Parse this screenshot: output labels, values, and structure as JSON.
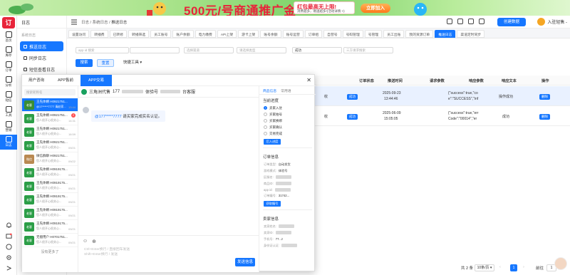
{
  "banner": {
    "title": "500元/号商通推广金",
    "sub1": "红包最高无上限!",
    "sub2": "消费越多，赠送越多!(活动详情 >)",
    "cta": "立即加入"
  },
  "rail": {
    "logo": "订",
    "items": [
      {
        "label": "首页"
      },
      {
        "label": "库存"
      },
      {
        "label": "订单"
      },
      {
        "label": "分析"
      },
      {
        "label": "短信"
      },
      {
        "label": "工具"
      },
      {
        "label": "营销"
      },
      {
        "label": "日志"
      }
    ]
  },
  "sidebar": {
    "header": "日志",
    "group": "系统日志",
    "items": [
      {
        "label": "推送日志"
      },
      {
        "label": "同步日志"
      },
      {
        "label": "短信查看日志"
      }
    ]
  },
  "topbar": {
    "crumb1": "日志",
    "crumb2": "系统日志",
    "crumb3": "推送日志",
    "create": "创建数据",
    "user": "入驻轻售 -"
  },
  "tabs": [
    "设置访问",
    "转播费",
    "已转修",
    "转播筛选",
    "员工账号",
    "账户余额",
    "电力缴费",
    "API上架",
    "游卡上架",
    "账号余额",
    "账号运营",
    "订单组",
    "自营号",
    "号码管理",
    "号管理",
    "员工出账",
    "我的资源订单",
    "推送日志",
    "渠道定时同步"
  ],
  "filters": {
    "f1": "app id 搜索",
    "f2": "",
    "f3": "选择渠道",
    "f4": "请选择类型",
    "f5": "成功",
    "f6": "三方请求搜索",
    "search": "搜索",
    "reset": "重置",
    "quick": "快捷工具"
  },
  "table": {
    "headers": [
      "订单状态",
      "推送时间",
      "请求参数",
      "响应参数",
      "响应文本",
      "操作"
    ],
    "rows": [
      {
        "left": "收",
        "status": "成功",
        "time1": "2025-09-23",
        "time2": "13:44:46",
        "resp1": "{\"success\":true,\"co",
        "resp2": "e\":\"SUCCESS\",\"inf",
        "text": "操作成功",
        "op": "删除"
      },
      {
        "left": "收",
        "status": "成功",
        "time1": "2025-06-09",
        "time2": "15:05:05",
        "resp1": "{\"success\":true,\"err",
        "resp2": "Code\":\"00014\",\"er",
        "text": "成功",
        "op": "删除"
      }
    ]
  },
  "pager": {
    "total": "共 2 条",
    "size": "10条/页",
    "page": "1",
    "goto": "前往",
    "goto_val": "1",
    "page_suffix": "页"
  },
  "chat": {
    "tabs": [
      "用户咨询",
      "APP售前",
      "APP交易"
    ],
    "search": "搜索昵称名",
    "contacts": [
      {
        "name": "王先体婿 H0921751...",
        "preview": "@17*****7777 请赵家...",
        "time": "13:44",
        "avatar": "老客",
        "color": "#3a8d35",
        "badge": ""
      },
      {
        "name": "王先体婿 H0921751...",
        "preview": "您人很开心很关心...",
        "time": "14:31",
        "avatar": "老客",
        "color": "#2c9e47",
        "badge": "2"
      },
      {
        "name": "王先体婿 H0921751...",
        "preview": "您人很开心很关心...",
        "time": "16:59",
        "avatar": "老客",
        "color": "#2c9e47",
        "badge": ""
      },
      {
        "name": "王先体婿 H0921751...",
        "preview": "您人很开心很关心...",
        "time": "09/21",
        "avatar": "老客",
        "color": "#2c9e47",
        "badge": ""
      },
      {
        "name": "微信群聊 H0921751...",
        "preview": "您人很开心很关心...",
        "time": "09/22",
        "avatar": "微信",
        "color": "#b98952",
        "badge": ""
      },
      {
        "name": "王先体婿 H0919175...",
        "preview": "您人很开心很关心...",
        "time": "09/21",
        "avatar": "老客",
        "color": "#2c9e47",
        "badge": ""
      },
      {
        "name": "王先体婿 H0919175...",
        "preview": "您人很开心很关心...",
        "time": "09/21",
        "avatar": "老客",
        "color": "#2c9e47",
        "badge": ""
      },
      {
        "name": "王先体婿 H0919175...",
        "preview": "您人很开心很关心...",
        "time": "09/21",
        "avatar": "老客",
        "color": "#2c9e47",
        "badge": ""
      },
      {
        "name": "王先体婿 H0919175...",
        "preview": "您人很开心很关心...",
        "time": "09/21",
        "avatar": "老客",
        "color": "#2c9e47",
        "badge": ""
      },
      {
        "name": "王先体婿 H0919175...",
        "preview": "您人很开心很关心...",
        "time": "09/21",
        "avatar": "老客",
        "color": "#2c9e47",
        "badge": ""
      },
      {
        "name": "无偿用户 H0701751...",
        "preview": "您人很开心很关心...",
        "time": "09/21",
        "avatar": "老客",
        "color": "#2c9e47",
        "badge": ""
      }
    ],
    "more": "没有更多了",
    "header_name": "三角洲代售",
    "header_num": "177",
    "header_mid": "体验号",
    "header_tail": "台客服",
    "msg_at": "@177*****7777",
    "msg_text": "请买家完成实名认证。",
    "input_tools": [
      "☺",
      "⊕"
    ],
    "input_ph1": "Ctrl+Enter换行 / 直接回车发送",
    "input_ph2": "Shift+Enter换行 / 发送",
    "send": "发送信息"
  },
  "info": {
    "tab_on": "商品信息",
    "tab_off": "常用语",
    "stage_title": "当前进度",
    "stages": [
      {
        "label": "卖家入驻",
        "on": true
      },
      {
        "label": "买家拍号",
        "on": false
      },
      {
        "label": "买家换绑",
        "on": false
      },
      {
        "label": "买家确认",
        "on": false
      },
      {
        "label": "交易完成",
        "on": false
      }
    ],
    "stage_btn": "后入进度",
    "order_title": "订单信息",
    "order_kv": [
      {
        "k": "订单类型:",
        "v": "自动发货"
      },
      {
        "k": "游戏模式:",
        "v": "体验号"
      },
      {
        "k": "区服名:",
        "v": ""
      },
      {
        "k": "商品ID:",
        "v": ""
      },
      {
        "k": "app id:",
        "v": ""
      },
      {
        "k": "订单编号:",
        "v": "31742..."
      }
    ],
    "order_btn": "获取编号",
    "seller_title": "卖家信息",
    "seller_kv": [
      {
        "k": "卖家姓名:",
        "v": ""
      },
      {
        "k": "卖家ID:",
        "v": ""
      },
      {
        "k": "手机号:",
        "v": "77...z"
      },
      {
        "k": "身份证认证:",
        "v": ""
      }
    ]
  }
}
